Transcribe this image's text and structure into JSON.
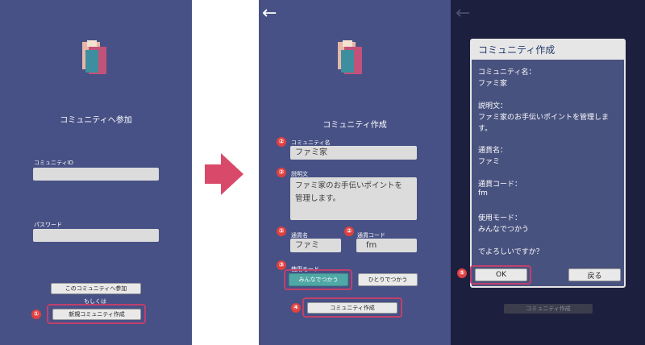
{
  "screen1": {
    "title": "コミュニティへ参加",
    "community_id_label": "コミュニティID",
    "community_id_value": "",
    "password_label": "パスワード",
    "password_value": "",
    "join_button": "このコミュニティへ参加",
    "or_text": "もしくは",
    "create_button": "新規コミュニティ作成",
    "marker": "①"
  },
  "screen2": {
    "title": "コミュニティ作成",
    "name_label": "コミュニティ名",
    "name_value": "ファミ家",
    "desc_label": "説明文",
    "desc_line1": "ファミ家のお手伝いポイントを",
    "desc_line2": "管理します。",
    "currency_label": "通貨名",
    "currency_value": "ファミ",
    "code_label": "通貨コード",
    "code_value": "fm",
    "mode_label": "使用モード",
    "mode_shared": "みんなでつかう",
    "mode_solo": "ひとりでつかう",
    "create_button": "コミュニティ作成",
    "markers": {
      "name": "②",
      "desc": "②",
      "currency": "②",
      "code": "②",
      "mode": "③",
      "create": "④"
    }
  },
  "screen3": {
    "dialog_title": "コミュニティ作成",
    "lines": [
      "コミュニティ名：",
      "ファミ家",
      "説明文：",
      "ファミ家のお手伝いポイントを管理しま",
      "す。",
      "通貨名：",
      "ファミ",
      "通貨コード：",
      "fm",
      "使用モード：",
      "みんなでつかう",
      "でよろしいですか？"
    ],
    "ok_button": "OK",
    "back_button": "戻る",
    "bottom_button": "コミュニティ作成",
    "marker": "⑤"
  },
  "colors": {
    "panel": "#475185",
    "dark_panel": "#1c1f3d",
    "highlight": "#c0406b",
    "arrow": "#d94a6a",
    "teal_button": "#4fa8a5"
  }
}
